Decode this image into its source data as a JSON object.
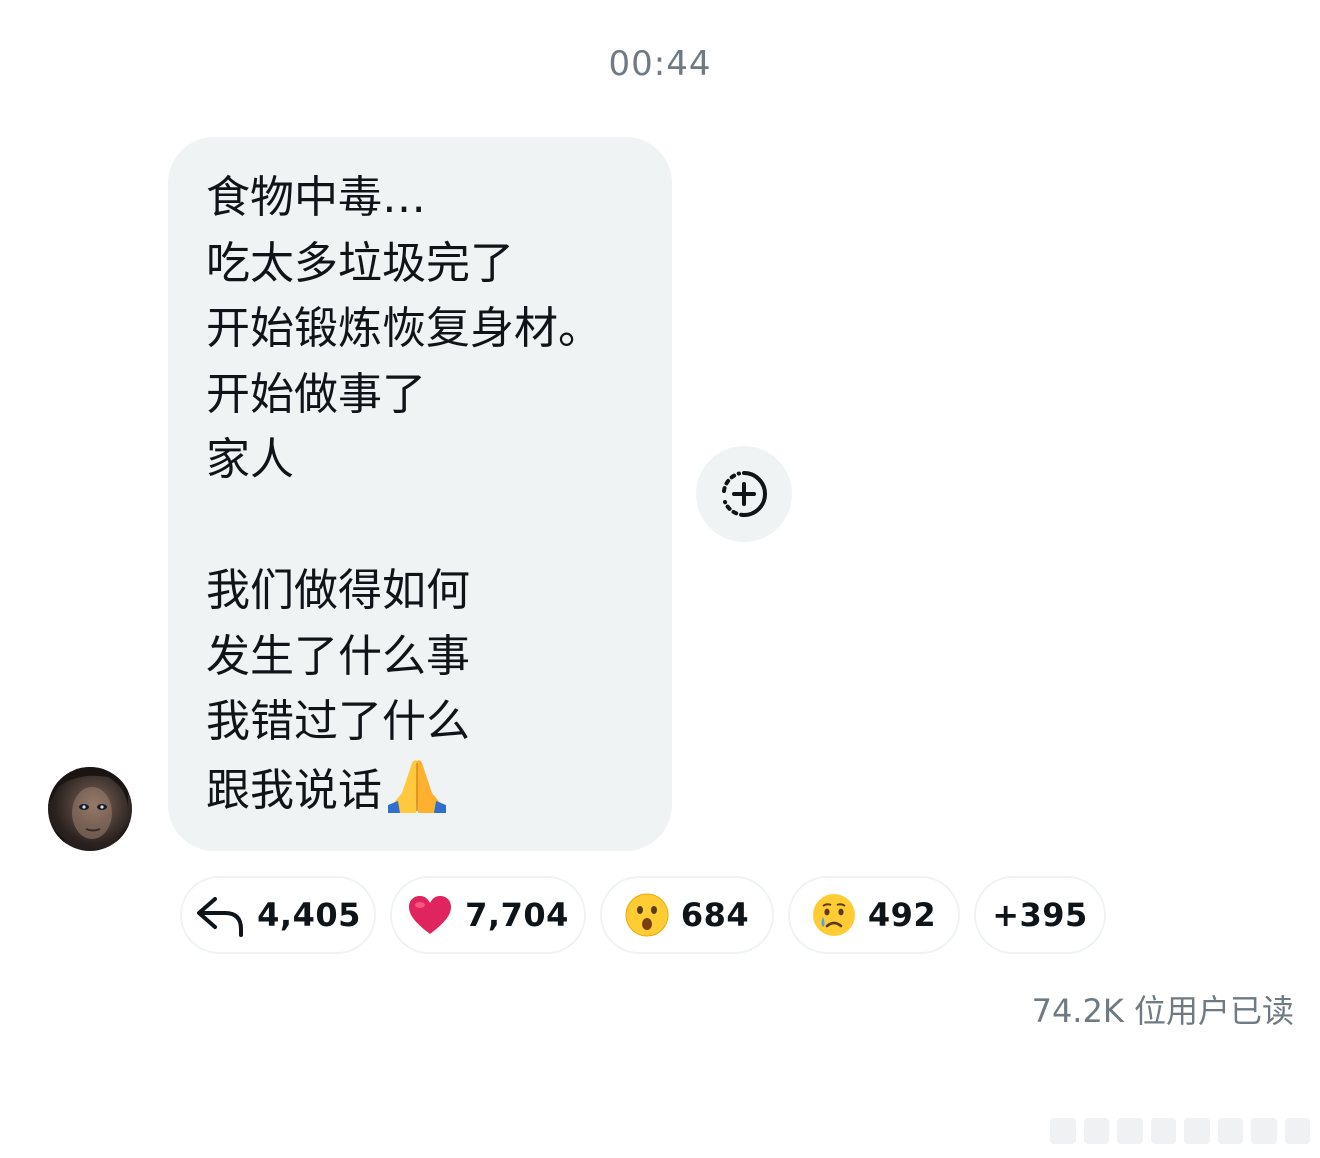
{
  "header": {
    "timestamp": "00:44"
  },
  "message": {
    "lines": [
      "食物中毒…",
      "吃太多垃圾完了",
      "开始锻炼恢复身材。",
      "开始做事了",
      "家人",
      "",
      "我们做得如何",
      "发生了什么事",
      "我错过了什么",
      "跟我说话"
    ],
    "trailing_emoji": "folded-hands-emoji"
  },
  "reactions": {
    "add_reaction_icon": "add-reaction-icon",
    "items": [
      {
        "icon": "reply-arrow-icon",
        "count": "4,405"
      },
      {
        "icon": "red-heart-emoji",
        "count": "7,704"
      },
      {
        "icon": "surprised-face-emoji",
        "count": "684"
      },
      {
        "icon": "crying-face-emoji",
        "count": "492"
      },
      {
        "icon": "",
        "count": "+395"
      }
    ]
  },
  "footer": {
    "read_count": "74.2K 位用户已读"
  },
  "colors": {
    "bubble_bg": "#eff3f4",
    "text": "#0f1419",
    "muted_text": "#6f7a83",
    "heart": "#e0245e"
  }
}
